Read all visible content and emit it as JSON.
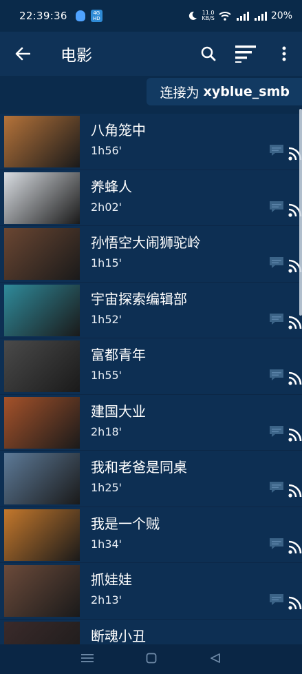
{
  "status_bar": {
    "time": "22:39:36",
    "hd_badge": "4G HD",
    "speed_value": "11.0",
    "speed_unit": "KB/S",
    "battery": "20%"
  },
  "app_bar": {
    "title": "电影"
  },
  "banner": {
    "prefix": "连接为",
    "user": "xyblue_smb"
  },
  "movies": [
    {
      "title": "八角笼中",
      "duration": "1h56'",
      "poster_bg": "#b5733a"
    },
    {
      "title": "养蜂人",
      "duration": "2h02'",
      "poster_bg": "#d9dde2"
    },
    {
      "title": "孙悟空大闹狮驼岭",
      "duration": "1h15'",
      "poster_bg": "#6a4632"
    },
    {
      "title": "宇宙探索编辑部",
      "duration": "1h52'",
      "poster_bg": "#2f8a9a"
    },
    {
      "title": "富都青年",
      "duration": "1h55'",
      "poster_bg": "#4a4a4a"
    },
    {
      "title": "建国大业",
      "duration": "2h18'",
      "poster_bg": "#a5522a"
    },
    {
      "title": "我和老爸是同桌",
      "duration": "1h25'",
      "poster_bg": "#5d7a98"
    },
    {
      "title": "我是一个贼",
      "duration": "1h34'",
      "poster_bg": "#c4782c"
    },
    {
      "title": "抓娃娃",
      "duration": "2h13'",
      "poster_bg": "#6b4a3a"
    },
    {
      "title": "断魂小丑",
      "duration": "",
      "poster_bg": "#3a2a2a"
    }
  ]
}
